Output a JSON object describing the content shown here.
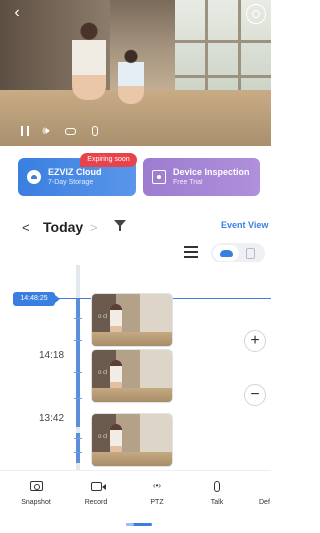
{
  "player": {
    "icons": {
      "back": "chevron-left-icon",
      "settings": "settings-icon",
      "pause": "pause-icon",
      "volume": "volume-icon",
      "screenshot": "camera-icon",
      "mic": "mic-icon"
    }
  },
  "services": {
    "cloud": {
      "title": "EZVIZ Cloud",
      "subtitle": "7-Day Storage",
      "badge": "Expiring soon",
      "color": "#3a7fe0"
    },
    "inspection": {
      "title": "Device Inspection",
      "subtitle": "Free Trial",
      "color": "#a284d6"
    }
  },
  "date_nav": {
    "prev": "<",
    "label": "Today",
    "next": ">"
  },
  "event_view": "Event View",
  "view_toggle": {
    "selected": "cloud"
  },
  "timeline": {
    "current_time": "14:48:25",
    "hour_labels": [
      "14:18",
      "13:42"
    ],
    "thumb_watermark": "o cl",
    "accent": "#3a7fe0"
  },
  "zoom": {
    "in": "+",
    "out": "−"
  },
  "toolbar": {
    "items": [
      {
        "label": "Snapshot",
        "icon": "snapshot-icon"
      },
      {
        "label": "Record",
        "icon": "record-icon"
      },
      {
        "label": "PTZ",
        "icon": "ptz-icon"
      },
      {
        "label": "Talk",
        "icon": "talk-icon"
      },
      {
        "label": "Def",
        "icon": "definition-icon"
      }
    ]
  }
}
